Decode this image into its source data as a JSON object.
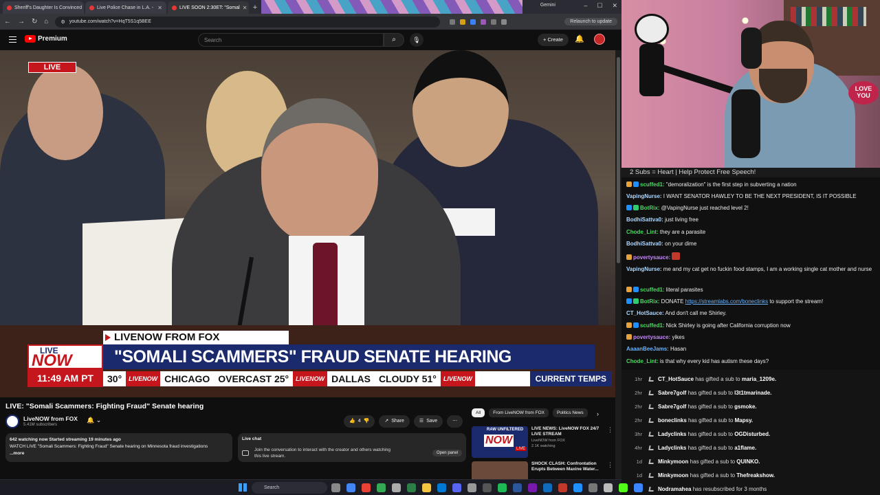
{
  "browser": {
    "tabs": [
      {
        "label": "Sheriff's Daughter Is Convinced"
      },
      {
        "label": "Live Police Chase in L.A. -"
      },
      {
        "label": "LIVE SOON 2:30ET: \"Somal"
      }
    ],
    "gemini_label": "Gemini",
    "url": "youtube.com/watch?v=HqT5S1q5BEE",
    "relaunch_label": "Relaunch to update"
  },
  "youtube": {
    "logo_text": "Premium",
    "search_placeholder": "Search",
    "create_label": "Create"
  },
  "video": {
    "live_badge": "LIVE",
    "source_bar": "LIVENOW FROM FOX",
    "headline": "\"SOMALI SCAMMERS\" FRAUD SENATE HEARING",
    "now_top": "LIVE",
    "now_main": "NOW",
    "time": "11:49 AM PT",
    "ticker": {
      "temp1": "30°",
      "logo": "LIVENOW",
      "city1": "CHICAGO",
      "cond1": "OVERCAST 25°",
      "city2": "DALLAS",
      "cond2": "CLOUDY 51°",
      "end": "CURRENT TEMPS"
    },
    "title": "LIVE: \"Somali Scammers: Fighting Fraud\" Senate hearing",
    "channel": "LiveNOW from FOX",
    "subscribers": "5.41M subscribers",
    "likes": "4",
    "share_label": "Share",
    "save_label": "Save",
    "desc_stats": "642 watching now  Started streaming 19 minutes ago",
    "desc_text": "WATCH LIVE \"Somali Scammers: Fighting Fraud\" Senate hearing on Minnesota fraud investigations",
    "desc_more": "...more",
    "livechat_title": "Live chat",
    "livechat_text": "Join the conversation to interact with the creator and others watching this live stream.",
    "open_panel_label": "Open panel"
  },
  "recs": {
    "chips": [
      "All",
      "From LiveNOW from FOX",
      "Politics News"
    ],
    "items": [
      {
        "title": "LIVE NEWS: LiveNOW FOX 24/7 LIVE STREAM",
        "channel": "LiveNOW from FOX",
        "meta": "2.1K watching",
        "badge": "LIVE",
        "thumb_top": "RAW UNFILTERED",
        "thumb_main": "NOW"
      },
      {
        "title": "SHOCK CLASH: Confrontation Erupts Between Maxine Water...",
        "channel": "",
        "meta": "",
        "badge": "",
        "thumb_top": "",
        "thumb_main": ""
      }
    ]
  },
  "stream": {
    "banner": "2 Subs = Heart | Help Protect Free Speech!",
    "love_sign": "LOVE YOU",
    "chat": [
      {
        "user": "scuffed1:",
        "text": " \"demoralization\" is the first step in subverting a nation",
        "color": "#4cd964"
      },
      {
        "user": "VapingNurse:",
        "text": " I WANT SENATOR HAWLEY TO BE THE NEXT PRESIDENT, IS IT POSSIBLE",
        "color": "#b0d9ff"
      },
      {
        "user": "BotRix:",
        "text": " @VapingNurse just reached level 2!",
        "color": "#4cd964"
      },
      {
        "user": "BodhiSattva0:",
        "text": " just living free",
        "color": "#b0d9ff"
      },
      {
        "user": "Chode_Lint:",
        "text": " they are a parasite",
        "color": "#4cd964"
      },
      {
        "user": "BodhiSattva0:",
        "text": " on your dime",
        "color": "#b0d9ff"
      },
      {
        "user": "povertysauce:",
        "text": "",
        "color": "#c58af9"
      },
      {
        "user": "VapingNurse:",
        "text": " me and my cat get no fuckin food stamps, I am a working single cat mother and nurse",
        "color": "#b0d9ff"
      },
      {
        "user": "scuffed1:",
        "text": " literal parasites",
        "color": "#4cd964"
      },
      {
        "user": "BotRix:",
        "text": " DONATE ",
        "link": "https://streamlabs.com/boneclinks",
        "after": " to support the stream!",
        "color": "#4cd964"
      },
      {
        "user": "CT_HotSauce:",
        "text": " And don't call me Shirley.",
        "color": "#b0d9ff"
      },
      {
        "user": "scuffed1:",
        "text": " Nick Shirley is going after California corruption now",
        "color": "#4cd964"
      },
      {
        "user": "povertysauce:",
        "text": " yikes",
        "color": "#c58af9"
      },
      {
        "user": "AaaanBeeJams:",
        "text": " Hasan",
        "color": "#b0d9ff"
      },
      {
        "user": "Chode_Lint:",
        "text": " is that why every kid has autism these days?",
        "color": "#4cd964"
      }
    ],
    "gifts": [
      {
        "time": "1hr",
        "from": "CT_HotSauce",
        "action": " has gifted a sub to ",
        "to": "maria_1209e."
      },
      {
        "time": "2hr",
        "from": "Sabre7golf",
        "action": " has gifted a sub to ",
        "to": "l3t1tmarinade."
      },
      {
        "time": "2hr",
        "from": "Sabre7golf",
        "action": " has gifted a sub to ",
        "to": "gsmoke."
      },
      {
        "time": "2hr",
        "from": "boneclinks",
        "action": " has gifted a sub to ",
        "to": "Mapsy."
      },
      {
        "time": "3hr",
        "from": "Ladyclinks",
        "action": " has gifted a sub to ",
        "to": "OGDisturbed."
      },
      {
        "time": "4hr",
        "from": "Ladyclinks",
        "action": " has gifted a sub to ",
        "to": "a1flame."
      },
      {
        "time": "1d",
        "from": "Minkymoon",
        "action": " has gifted a sub to ",
        "to": "QUINKO."
      },
      {
        "time": "1d",
        "from": "Minkymoon",
        "action": " has gifted a sub to ",
        "to": "Thefreakshow."
      },
      {
        "time": "1d",
        "from": "Nodramahea",
        "action": " has resubscribed for 3 months",
        "to": ""
      }
    ]
  },
  "taskbar": {
    "search_label": "Search"
  }
}
